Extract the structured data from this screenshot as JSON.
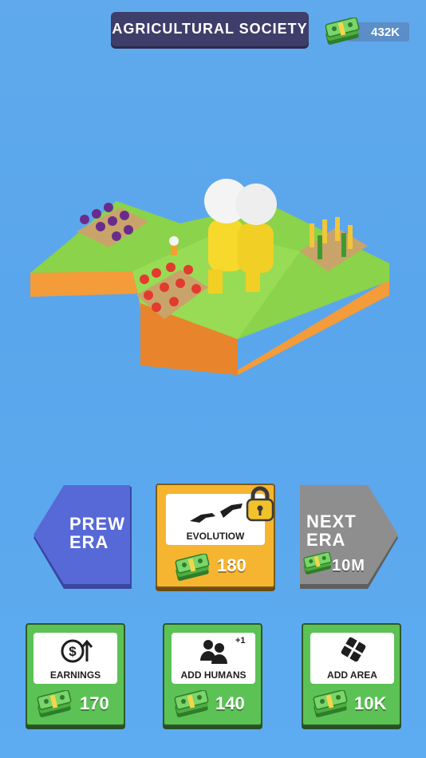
{
  "header": {
    "era_title": "AGRICULTURAL SOCIETY",
    "money": "432K"
  },
  "era_nav": {
    "prev_label": "PREW\nERA",
    "next_label": "NEXT\nERA",
    "next_price": "10M"
  },
  "evolution": {
    "label": "EVOLUTIOW",
    "price": "180",
    "locked": true
  },
  "upgrades": [
    {
      "label": "EARNINGS",
      "price": "170",
      "icon": "dollar-up-icon"
    },
    {
      "label": "ADD HUMANS",
      "price": "140",
      "icon": "add-humans-icon",
      "badge": "+1"
    },
    {
      "label": "ADD AREA",
      "price": "10K",
      "icon": "area-tiles-icon"
    }
  ],
  "colors": {
    "prev_era": "#5769d6",
    "next_era": "#8e8e8e",
    "evolution": "#f6b531",
    "upgrade": "#5cc255",
    "title_bg": "#3f3d6a"
  }
}
